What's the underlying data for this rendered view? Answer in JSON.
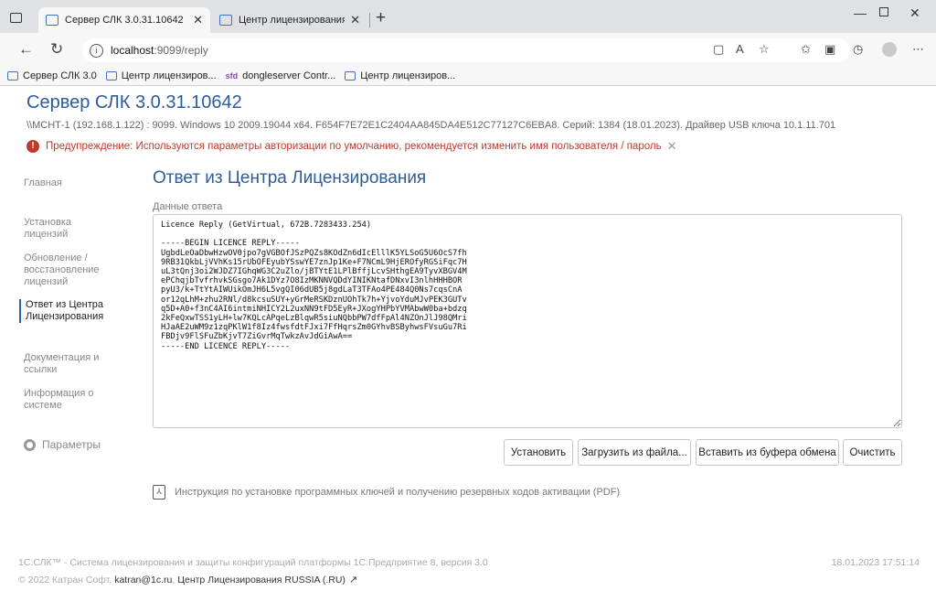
{
  "browser": {
    "tabs": [
      {
        "title": "Сервер СЛК 3.0.31.10642",
        "active": true
      },
      {
        "title": "Центр лицензирования СЛК.R",
        "active": false
      }
    ],
    "new_tab": "+",
    "url_host": "localhost",
    "url_path": ":9099/reply",
    "bookmarks": [
      {
        "label": "Сервер СЛК 3.0",
        "icon": "page-icon"
      },
      {
        "label": "Центр лицензиров...",
        "icon": "page-icon"
      },
      {
        "label": "dongleserver Contr...",
        "icon": "sfd-icon",
        "icon_text": "sfd"
      },
      {
        "label": "Центр лицензиров...",
        "icon": "page-icon"
      }
    ]
  },
  "header": {
    "title": "Сервер СЛК 3.0.31.10642",
    "server_info": "\\\\МСНТ-1 (192.168.1.122) : 9099.  Windows 10 2009.19044 x64.  F654F7E72E1C2404AA845DA4E512C77127C6EBA8.  Серий: 1384 (18.01.2023).  Драйвер USB ключа 10.1.11.701",
    "warning": "Предупреждение: Используются параметры авторизации по умолчанию, рекомендуется изменить имя пользователя / пароль"
  },
  "sidebar": {
    "items": [
      {
        "label": "Главная",
        "active": false
      },
      {
        "label": "Установка лицензий",
        "active": false
      },
      {
        "label": "Обновление / восстановление лицензий",
        "active": false
      },
      {
        "label": "Ответ из Центра Лицензирования",
        "active": true
      },
      {
        "label": "Документация и ссылки",
        "active": false
      },
      {
        "label": "Информация о системе",
        "active": false
      }
    ],
    "params_label": "Параметры"
  },
  "main": {
    "section_title": "Ответ из Центра Лицензирования",
    "field_label": "Данные ответа",
    "reply_text": "Licence Reply (GetVirtual, 672B.7283433.254)\n\n-----BEGIN LICENCE REPLY-----\nUgbdLeOaDbwHzwOV0jpo7gVGBOfJSzPQZs8KOdZn6dIcElllK5YLSoG5U6OcS7fh\n9RB31QkbLjVVhKs15rUbOFEyubYSswYE7znJp1Ke+F7NCmL9HjEROfyRGSiFqc7H\nuL3tQnj3oi2WJDZ7IGhqWG3C2uZlo/jBTYtE1LPlBffjLcvSHthgEA9TyvXBGV4M\nePChqjbTvfrhvkSGsgo7Ak1DYz7O8IzMKNNVQDdYINIKNtafDNxvI3nlhHHHBOR\npyU3/k+TtYtAIWUikOmJH6L5vgQI06dUB5j8gdLaT3TFAo4PE484Q0Ns7cqsCnA\nor12qLhM+zhu2RNl/d8kcsuSUY+yGrMeRSKDznUOhTk7h+YjvoYduMJvPEK3GUTv\nq5D+A0+f3nC4AI6intmiNHICY2L2uxNN9tFD5EyR+JXogYHPbYVMAbwW0ba+bdzq\n2kFeQxwTSS1yLH+lw7KQLcAPqeLzBlqwR5siuNQbbPW7dfFpAl4NZOnJlJ98QMri\nHJaAE2uWM9z1zqPKlW1f8Iz4fwsfdtFJxi7FfHqrsZm0GYhvBSByhwsFVsuGu7Ri\nFBDjv9FlSFuZbKjvT7ZiGvrMqTwkzAvJdGiAwA==\n-----END LICENCE REPLY-----",
    "buttons": {
      "install": "Установить",
      "load_file": "Загрузить из файла...",
      "paste": "Вставить из буфера обмена",
      "clear": "Очистить"
    },
    "pdf_link": "Инструкция по установке программных ключей и получению резервных кодов активации (PDF)"
  },
  "footer": {
    "line1": "1С:СЛК™ - Система лицензирования и защиты конфигураций платформы 1С:Предприятие 8, версия 3.0",
    "copyright": "© 2022 Катран Софт,",
    "email": "katran@1c.ru",
    "center_link": "Центр Лицензирования RUSSIA (.RU)",
    "datetime": "18.01.2023 17:51:14"
  }
}
